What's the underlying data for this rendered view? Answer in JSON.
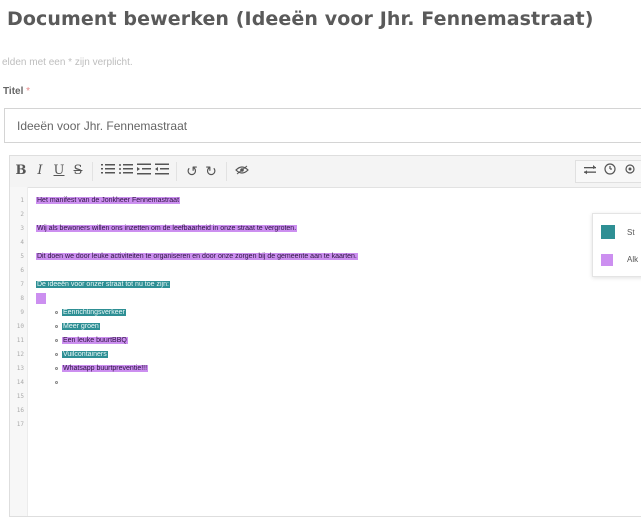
{
  "header": {
    "title": "Document bewerken (Ideeën voor Jhr. Fennemastraat)",
    "required_note": "elden met een * zijn verplicht.",
    "title_label": "Titel",
    "required_star": "*"
  },
  "title_field": {
    "value": "Ideeën voor Jhr. Fennemastraat"
  },
  "toolbar": {
    "bold": "B",
    "italic": "I",
    "underline": "U",
    "strikethrough": "S",
    "undo": "↺",
    "redo": "↻"
  },
  "editor": {
    "line_numbers": [
      "1",
      "2",
      "3",
      "4",
      "5",
      "6",
      "7",
      "8",
      "9",
      "10",
      "11",
      "12",
      "13",
      "14",
      "15",
      "16",
      "17"
    ],
    "lines": {
      "l1": "Het manifest van de Jonkheer Fennemastraat",
      "l3": "Wij als bewoners willen ons inzetten om de leefbaarheid in onze straat te vergroten.",
      "l5": "Dit doen we door leuke activiteiten te organiseren en door onze zorgen bij de gemeente aan te kaarten.",
      "l7": "De ideeën voor onzer straat tot nu toe zijn:"
    },
    "list_items": [
      "Eenrichtingsverkeer",
      "Meer groen",
      "Een leuke buurtBBQ",
      "Vuilcontainers",
      "Whatsapp buurtpreventie!!!"
    ]
  },
  "legend": {
    "items": [
      {
        "label": "St",
        "color": "#2e8f94"
      },
      {
        "label": "Alk",
        "color": "#cc8ff0"
      }
    ]
  },
  "colors": {
    "highlight_purple": "#cc8ff0",
    "highlight_teal": "#2e8f94"
  }
}
